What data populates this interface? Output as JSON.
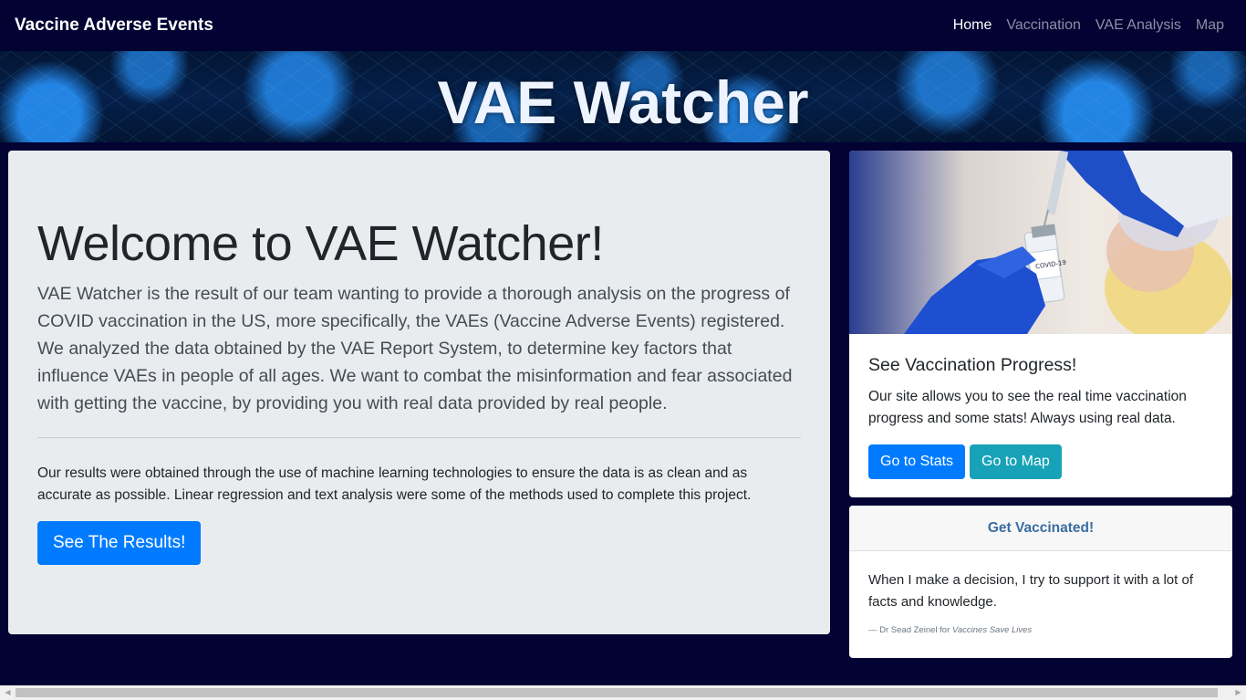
{
  "navbar": {
    "brand": "Vaccine Adverse Events",
    "links": [
      {
        "label": "Home",
        "active": true
      },
      {
        "label": "Vaccination",
        "active": false
      },
      {
        "label": "VAE Analysis",
        "active": false
      },
      {
        "label": "Map",
        "active": false
      }
    ]
  },
  "hero": {
    "title": "VAE Watcher"
  },
  "jumbotron": {
    "heading": "Welcome to VAE Watcher!",
    "lead": "VAE Watcher is the result of our team wanting to provide a thorough analysis on the progress of COVID vaccination in the US, more specifically, the VAEs (Vaccine Adverse Events) registered. We analyzed the data obtained by the VAE Report System, to determine key factors that influence VAEs in people of all ages. We want to combat the misinformation and fear associated with getting the vaccine, by providing you with real data provided by real people.",
    "body": "Our results were obtained through the use of machine learning technologies to ensure the data is as clean and as accurate as possible. Linear regression and text analysis were some of the methods used to complete this project.",
    "button_label": "See The Results!"
  },
  "vaccination_card": {
    "image_label": "COVID-19",
    "title": "See Vaccination Progress!",
    "text": "Our site allows you to see the real time vaccination progress and some stats! Always using real data.",
    "stats_button": "Go to Stats",
    "map_button": "Go to Map"
  },
  "quote_card": {
    "header": "Get Vaccinated!",
    "quote": "When I make a decision, I try to support it with a lot of facts and knowledge.",
    "footer_author": "— Dr Sead Zeinel for",
    "footer_source": "Vaccines Save Lives"
  },
  "colors": {
    "page_bg": "#020233",
    "primary": "#007bff",
    "info": "#17a2b8",
    "jumbotron_bg": "#e9ecef"
  },
  "scrollbar": {
    "left_icon": "arrow-left-icon",
    "right_icon": "arrow-right-icon"
  }
}
